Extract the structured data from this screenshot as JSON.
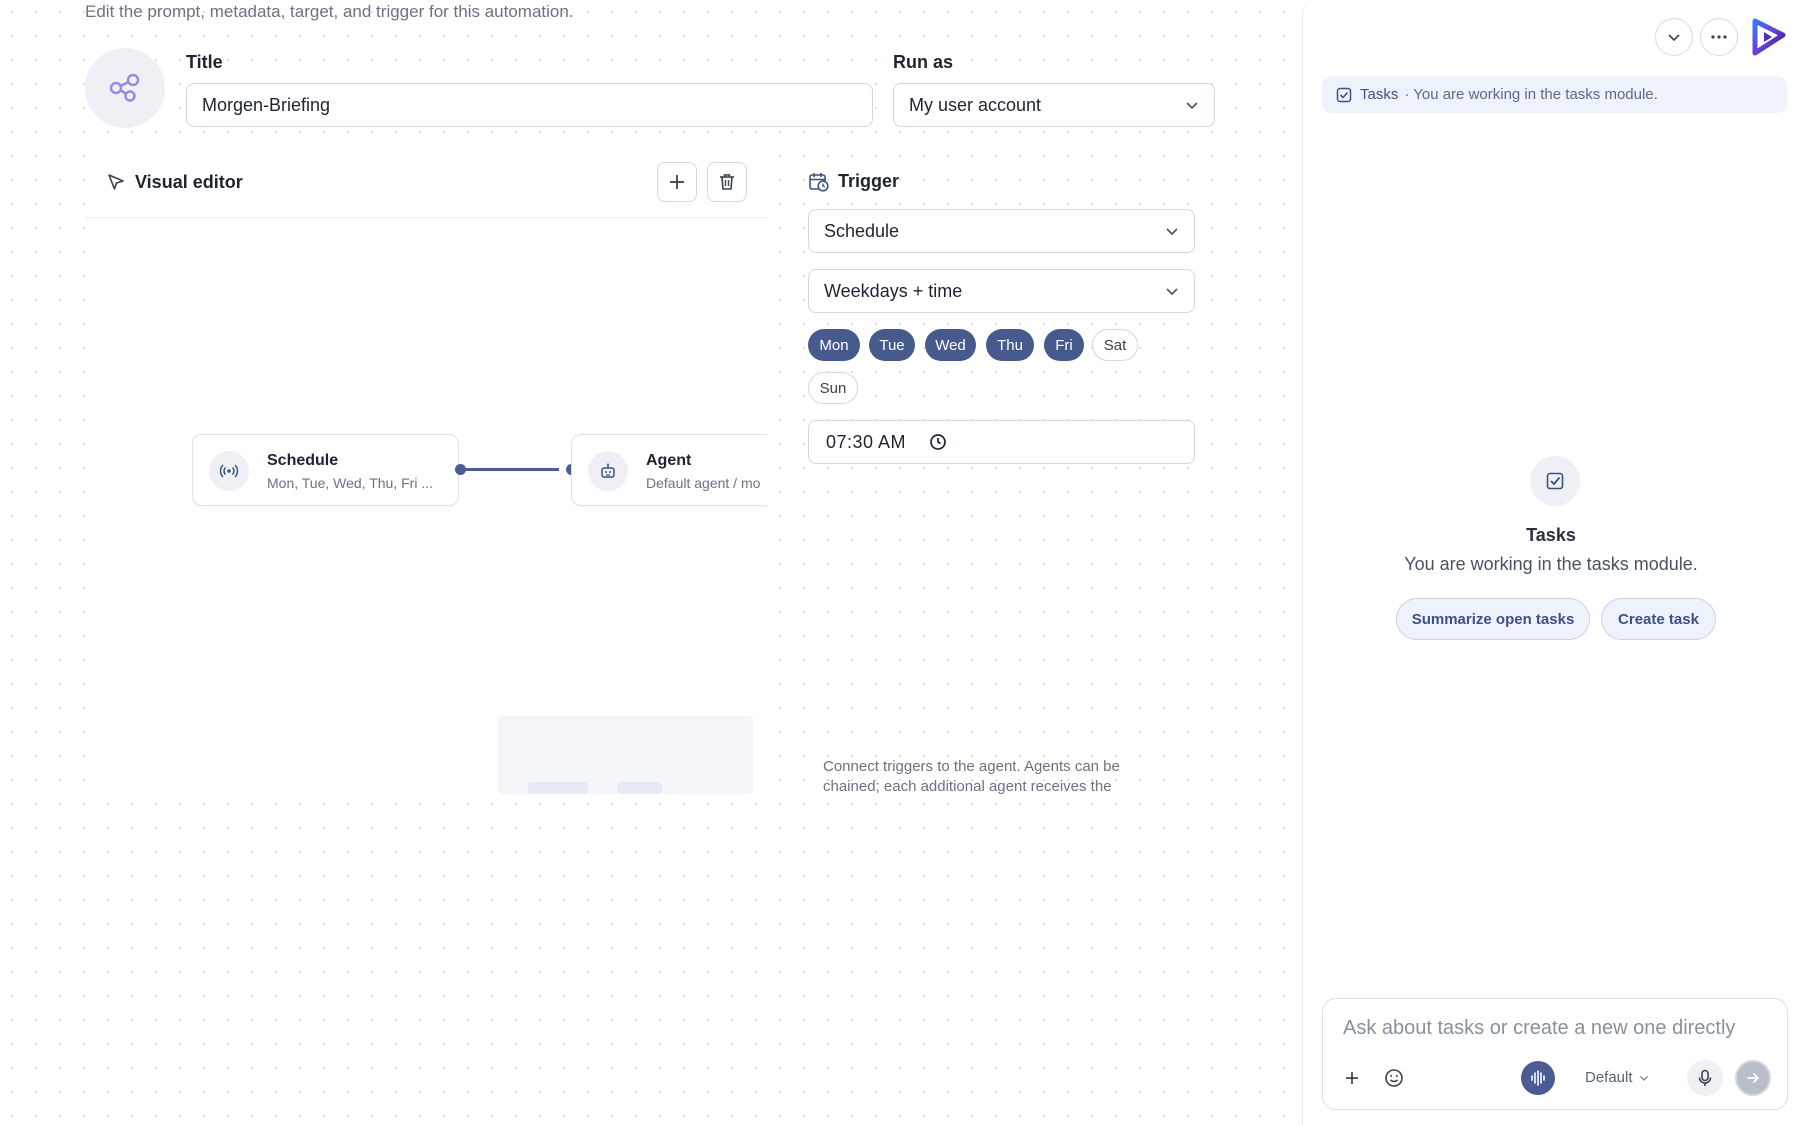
{
  "header": {
    "subtitle": "Edit the prompt, metadata, target, and trigger for this automation."
  },
  "form": {
    "title_label": "Title",
    "title_value": "Morgen-Briefing",
    "run_as_label": "Run as",
    "run_as_value": "My user account"
  },
  "editor": {
    "title": "Visual editor",
    "nodes": [
      {
        "title": "Schedule",
        "subtitle": "Mon, Tue, Wed, Thu, Fri ...",
        "icon": "broadcast-icon"
      },
      {
        "title": "Agent",
        "subtitle": "Default agent / mo",
        "icon": "robot-icon"
      }
    ]
  },
  "trigger": {
    "title": "Trigger",
    "type_value": "Schedule",
    "mode_value": "Weekdays + time",
    "days": [
      {
        "label": "Mon",
        "selected": true
      },
      {
        "label": "Tue",
        "selected": true
      },
      {
        "label": "Wed",
        "selected": true
      },
      {
        "label": "Thu",
        "selected": true
      },
      {
        "label": "Fri",
        "selected": true
      },
      {
        "label": "Sat",
        "selected": false
      },
      {
        "label": "Sun",
        "selected": false
      }
    ],
    "time": "07:30 AM",
    "help": "Connect triggers to the agent. Agents can be chained; each additional agent receives the"
  },
  "side": {
    "breadcrumb_module": "Tasks",
    "breadcrumb_text": "· You are working in the tasks module.",
    "empty_title": "Tasks",
    "empty_subtitle": "You are working in the tasks module.",
    "actions": [
      "Summarize open tasks",
      "Create task"
    ],
    "composer": {
      "placeholder": "Ask about tasks or create a new one directly",
      "model": "Default"
    }
  },
  "colors": {
    "accent": "#475a8e",
    "chip_off_border": "#d4d8e0",
    "breadcrumb_bg": "#eef2fb"
  }
}
